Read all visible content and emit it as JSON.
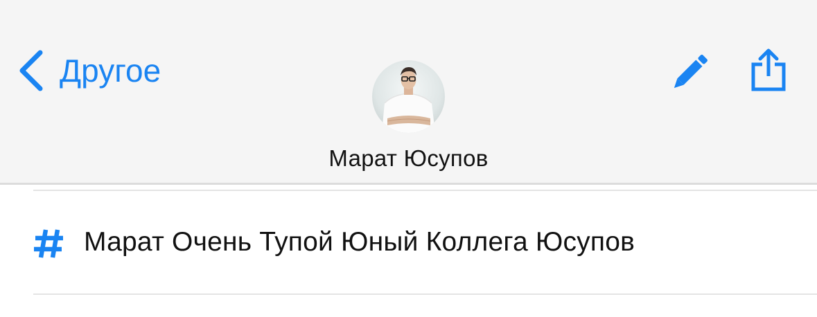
{
  "nav": {
    "back_label": "Другое",
    "contact_name": "Марат Юсупов"
  },
  "row": {
    "value": "Марат Очень Тупой Юный Коллега Юсупов"
  },
  "icons": {
    "back": "chevron-left-icon",
    "edit": "pencil-icon",
    "share": "share-icon",
    "hash": "hashtag-icon"
  },
  "colors": {
    "accent": "#1a84f2",
    "nav_background": "#f5f5f5",
    "text": "#111111"
  }
}
